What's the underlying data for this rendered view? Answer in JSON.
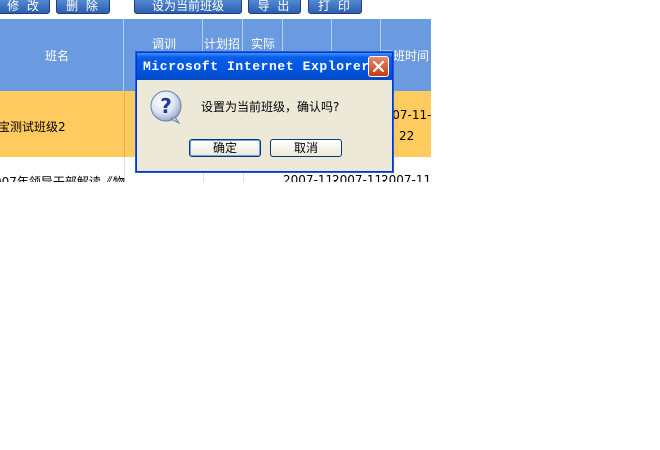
{
  "toolbar": {
    "edit": "修 改",
    "delete": "删 除",
    "set_current": "设为当前班级",
    "export": "导 出",
    "print": "打 印"
  },
  "table": {
    "headers": {
      "class_name": "班名",
      "adjust": "调训",
      "plan": "计划招",
      "actual": "实际",
      "start_time": "开班时间"
    },
    "rows": [
      {
        "name": "宝测试班级2",
        "date_part1": "2007-11-",
        "date_part2": "22"
      },
      {
        "name": "007年领导干部解读《物",
        "date1": "2007-11-",
        "date2": "2007-11-",
        "date3": "2007-11-"
      }
    ]
  },
  "dialog": {
    "title": "Microsoft Internet Explorer",
    "message": "设置为当前班级，确认吗?",
    "ok": "确定",
    "cancel": "取消",
    "icon": "question-icon"
  }
}
